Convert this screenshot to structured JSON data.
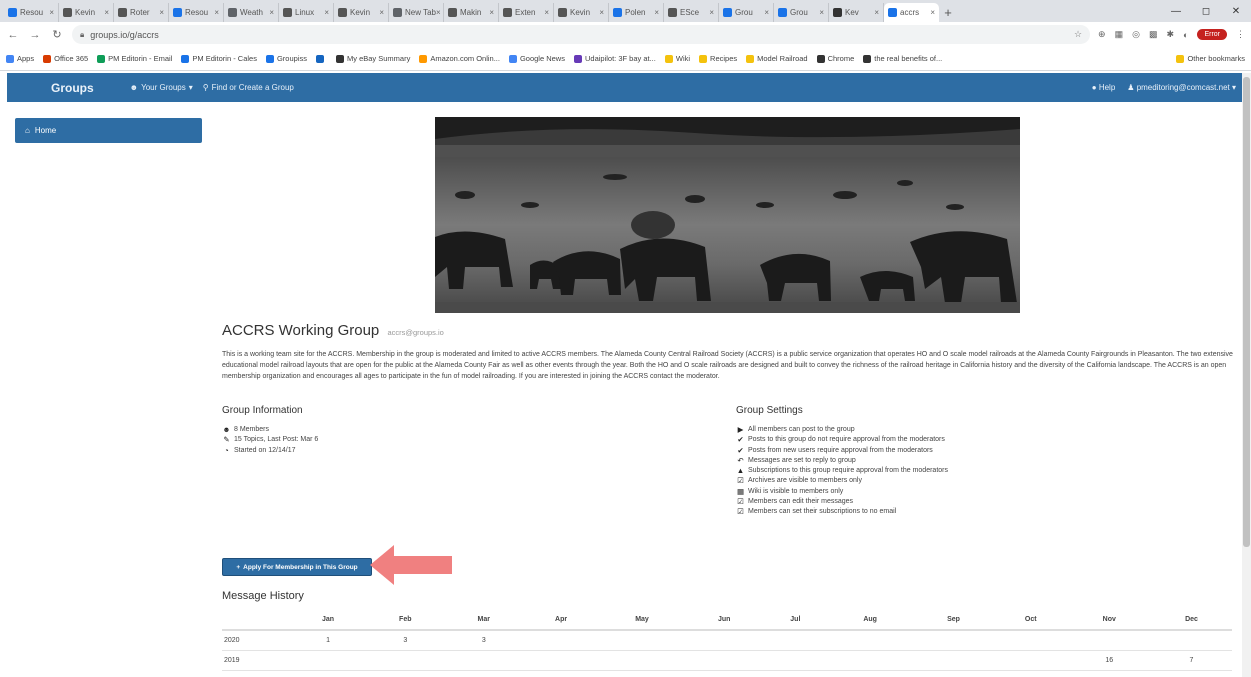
{
  "browser": {
    "tabs": [
      {
        "label": "Resou",
        "color": "#1a73e8"
      },
      {
        "label": "Kevin",
        "color": "#555555"
      },
      {
        "label": "Roter",
        "color": "#555555"
      },
      {
        "label": "Resou",
        "color": "#1a73e8"
      },
      {
        "label": "Weath",
        "color": "#5f6368"
      },
      {
        "label": "Linux",
        "color": "#555555"
      },
      {
        "label": "Kevin",
        "color": "#555555"
      },
      {
        "label": "New Tab",
        "color": "#5f6368"
      },
      {
        "label": "Makin",
        "color": "#555555"
      },
      {
        "label": "Exten",
        "color": "#555555"
      },
      {
        "label": "Kevin",
        "color": "#555555"
      },
      {
        "label": "Polen",
        "color": "#1a73e8"
      },
      {
        "label": "ESce",
        "color": "#555555"
      },
      {
        "label": "Grou",
        "color": "#1a73e8"
      },
      {
        "label": "Grou",
        "color": "#1a73e8"
      },
      {
        "label": "Kev",
        "color": "#333333"
      },
      {
        "label": "accrs",
        "color": "#1a73e8",
        "active": true
      }
    ],
    "url": "groups.io/g/accrs",
    "profile_label": "Error",
    "bookmarks": [
      {
        "label": "Apps",
        "color": "#4285f4"
      },
      {
        "label": "Office 365",
        "color": "#d83b01"
      },
      {
        "label": "PM Editorin - Email",
        "color": "#0f9d58"
      },
      {
        "label": "PM Editorin - Cales",
        "color": "#1a73e8"
      },
      {
        "label": "Groupiss",
        "color": "#1a73e8"
      },
      {
        "label": "",
        "color": "#1565c0"
      },
      {
        "label": "My eBay Summary",
        "color": "#333333"
      },
      {
        "label": "Amazon.com Onlin...",
        "color": "#ff9900"
      },
      {
        "label": "Google News",
        "color": "#4285f4"
      },
      {
        "label": "Udaipilot: 3F bay at...",
        "color": "#673ab7"
      },
      {
        "label": "Wiki",
        "color": "#f4c20d"
      },
      {
        "label": "Recipes",
        "color": "#f4c20d"
      },
      {
        "label": "Model Railroad",
        "color": "#f4c20d"
      },
      {
        "label": "Chrome",
        "color": "#333333"
      },
      {
        "label": "the real benefits of...",
        "color": "#333333"
      }
    ],
    "other_bookmarks": "Other bookmarks"
  },
  "site": {
    "brand": "Groups",
    "nav_your_groups": "Your Groups",
    "nav_find": "Find or Create a Group",
    "nav_help": "Help",
    "nav_user": "pmeditoring@comcast.net"
  },
  "sidebar": {
    "home_label": "Home"
  },
  "group": {
    "title": "ACCRS Working Group",
    "email": "accrs@groups.io",
    "description": "This is a working team site for the ACCRS. Membership in the group is moderated and limited to active ACCRS members. The Alameda County Central Railroad Society (ACCRS) is a public service organization that operates HO and O scale model railroads at the Alameda County Fairgrounds in Pleasanton. The two extensive educational model railroad layouts that are open for the public at the Alameda County Fair as well as other events through the year. Both the HO and O scale railroads are designed and built to convey the richness of the railroad heritage in California history and the diversity of the California landscape. The ACCRS is an open membership organization and encourages all ages to participate in the fun of model railroading. If you are interested in joining the ACCRS contact the moderator.",
    "info_heading": "Group Information",
    "info": [
      {
        "icon": "users-icon",
        "glyph": "☻",
        "text": "8 Members"
      },
      {
        "icon": "comments-icon",
        "glyph": "✎",
        "text": "15 Topics, Last Post: Mar 6"
      },
      {
        "icon": "clock-icon",
        "glyph": "◔",
        "text": "Started on 12/14/17"
      }
    ],
    "settings_heading": "Group Settings",
    "settings": [
      {
        "icon": "megaphone-icon",
        "glyph": "▶",
        "text": "All members can post to the group"
      },
      {
        "icon": "check-icon",
        "glyph": "✔",
        "text": "Posts to this group do not require approval from the moderators"
      },
      {
        "icon": "check-icon",
        "glyph": "✔",
        "text": "Posts from new users require approval from the moderators"
      },
      {
        "icon": "reply-icon",
        "glyph": "↶",
        "text": "Messages are set to reply to group"
      },
      {
        "icon": "lock-icon",
        "glyph": "▲",
        "text": "Subscriptions to this group require approval from the moderators"
      },
      {
        "icon": "archive-icon",
        "glyph": "☑",
        "text": "Archives are visible to members only"
      },
      {
        "icon": "wiki-icon",
        "glyph": "▦",
        "text": "Wiki is visible to members only"
      },
      {
        "icon": "edit-icon",
        "glyph": "☑",
        "text": "Members can edit their messages"
      },
      {
        "icon": "edit-icon",
        "glyph": "☑",
        "text": "Members can set their subscriptions to no email"
      }
    ],
    "apply_button": "Apply For Membership in This Group"
  },
  "history": {
    "title": "Message History",
    "columns": [
      "",
      "Jan",
      "Feb",
      "Mar",
      "Apr",
      "May",
      "Jun",
      "Jul",
      "Aug",
      "Sep",
      "Oct",
      "Nov",
      "Dec"
    ],
    "rows": [
      [
        "2020",
        "1",
        "3",
        "3",
        "",
        "",
        "",
        "",
        "",
        "",
        "",
        "",
        ""
      ],
      [
        "2019",
        "",
        "",
        "",
        "",
        "",
        "",
        "",
        "",
        "",
        "",
        "16",
        "7"
      ]
    ]
  },
  "annotation": {
    "arrow_color": "#f08080"
  }
}
